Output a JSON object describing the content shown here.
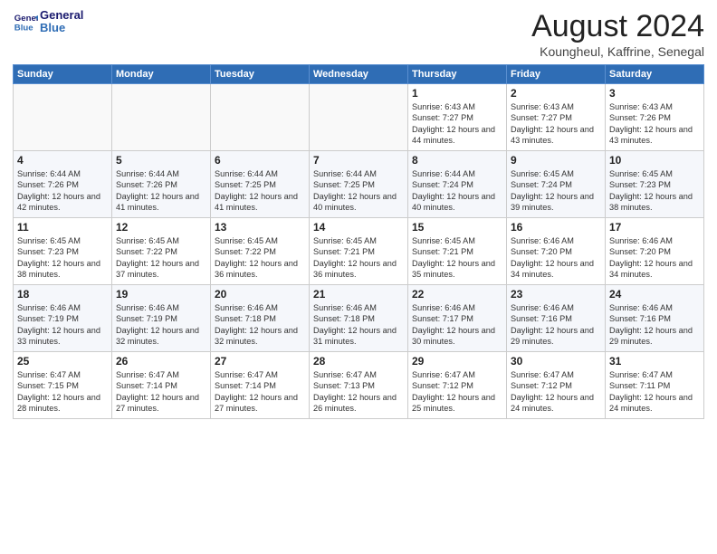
{
  "header": {
    "logo_line1": "General",
    "logo_line2": "Blue",
    "month_title": "August 2024",
    "subtitle": "Koungheul, Kaffrine, Senegal"
  },
  "days_of_week": [
    "Sunday",
    "Monday",
    "Tuesday",
    "Wednesday",
    "Thursday",
    "Friday",
    "Saturday"
  ],
  "weeks": [
    [
      {
        "day": "",
        "content": ""
      },
      {
        "day": "",
        "content": ""
      },
      {
        "day": "",
        "content": ""
      },
      {
        "day": "",
        "content": ""
      },
      {
        "day": "1",
        "content": "Sunrise: 6:43 AM\nSunset: 7:27 PM\nDaylight: 12 hours and 44 minutes."
      },
      {
        "day": "2",
        "content": "Sunrise: 6:43 AM\nSunset: 7:27 PM\nDaylight: 12 hours and 43 minutes."
      },
      {
        "day": "3",
        "content": "Sunrise: 6:43 AM\nSunset: 7:26 PM\nDaylight: 12 hours and 43 minutes."
      }
    ],
    [
      {
        "day": "4",
        "content": "Sunrise: 6:44 AM\nSunset: 7:26 PM\nDaylight: 12 hours and 42 minutes."
      },
      {
        "day": "5",
        "content": "Sunrise: 6:44 AM\nSunset: 7:26 PM\nDaylight: 12 hours and 41 minutes."
      },
      {
        "day": "6",
        "content": "Sunrise: 6:44 AM\nSunset: 7:25 PM\nDaylight: 12 hours and 41 minutes."
      },
      {
        "day": "7",
        "content": "Sunrise: 6:44 AM\nSunset: 7:25 PM\nDaylight: 12 hours and 40 minutes."
      },
      {
        "day": "8",
        "content": "Sunrise: 6:44 AM\nSunset: 7:24 PM\nDaylight: 12 hours and 40 minutes."
      },
      {
        "day": "9",
        "content": "Sunrise: 6:45 AM\nSunset: 7:24 PM\nDaylight: 12 hours and 39 minutes."
      },
      {
        "day": "10",
        "content": "Sunrise: 6:45 AM\nSunset: 7:23 PM\nDaylight: 12 hours and 38 minutes."
      }
    ],
    [
      {
        "day": "11",
        "content": "Sunrise: 6:45 AM\nSunset: 7:23 PM\nDaylight: 12 hours and 38 minutes."
      },
      {
        "day": "12",
        "content": "Sunrise: 6:45 AM\nSunset: 7:22 PM\nDaylight: 12 hours and 37 minutes."
      },
      {
        "day": "13",
        "content": "Sunrise: 6:45 AM\nSunset: 7:22 PM\nDaylight: 12 hours and 36 minutes."
      },
      {
        "day": "14",
        "content": "Sunrise: 6:45 AM\nSunset: 7:21 PM\nDaylight: 12 hours and 36 minutes."
      },
      {
        "day": "15",
        "content": "Sunrise: 6:45 AM\nSunset: 7:21 PM\nDaylight: 12 hours and 35 minutes."
      },
      {
        "day": "16",
        "content": "Sunrise: 6:46 AM\nSunset: 7:20 PM\nDaylight: 12 hours and 34 minutes."
      },
      {
        "day": "17",
        "content": "Sunrise: 6:46 AM\nSunset: 7:20 PM\nDaylight: 12 hours and 34 minutes."
      }
    ],
    [
      {
        "day": "18",
        "content": "Sunrise: 6:46 AM\nSunset: 7:19 PM\nDaylight: 12 hours and 33 minutes."
      },
      {
        "day": "19",
        "content": "Sunrise: 6:46 AM\nSunset: 7:19 PM\nDaylight: 12 hours and 32 minutes."
      },
      {
        "day": "20",
        "content": "Sunrise: 6:46 AM\nSunset: 7:18 PM\nDaylight: 12 hours and 32 minutes."
      },
      {
        "day": "21",
        "content": "Sunrise: 6:46 AM\nSunset: 7:18 PM\nDaylight: 12 hours and 31 minutes."
      },
      {
        "day": "22",
        "content": "Sunrise: 6:46 AM\nSunset: 7:17 PM\nDaylight: 12 hours and 30 minutes."
      },
      {
        "day": "23",
        "content": "Sunrise: 6:46 AM\nSunset: 7:16 PM\nDaylight: 12 hours and 29 minutes."
      },
      {
        "day": "24",
        "content": "Sunrise: 6:46 AM\nSunset: 7:16 PM\nDaylight: 12 hours and 29 minutes."
      }
    ],
    [
      {
        "day": "25",
        "content": "Sunrise: 6:47 AM\nSunset: 7:15 PM\nDaylight: 12 hours and 28 minutes."
      },
      {
        "day": "26",
        "content": "Sunrise: 6:47 AM\nSunset: 7:14 PM\nDaylight: 12 hours and 27 minutes."
      },
      {
        "day": "27",
        "content": "Sunrise: 6:47 AM\nSunset: 7:14 PM\nDaylight: 12 hours and 27 minutes."
      },
      {
        "day": "28",
        "content": "Sunrise: 6:47 AM\nSunset: 7:13 PM\nDaylight: 12 hours and 26 minutes."
      },
      {
        "day": "29",
        "content": "Sunrise: 6:47 AM\nSunset: 7:12 PM\nDaylight: 12 hours and 25 minutes."
      },
      {
        "day": "30",
        "content": "Sunrise: 6:47 AM\nSunset: 7:12 PM\nDaylight: 12 hours and 24 minutes."
      },
      {
        "day": "31",
        "content": "Sunrise: 6:47 AM\nSunset: 7:11 PM\nDaylight: 12 hours and 24 minutes."
      }
    ]
  ]
}
